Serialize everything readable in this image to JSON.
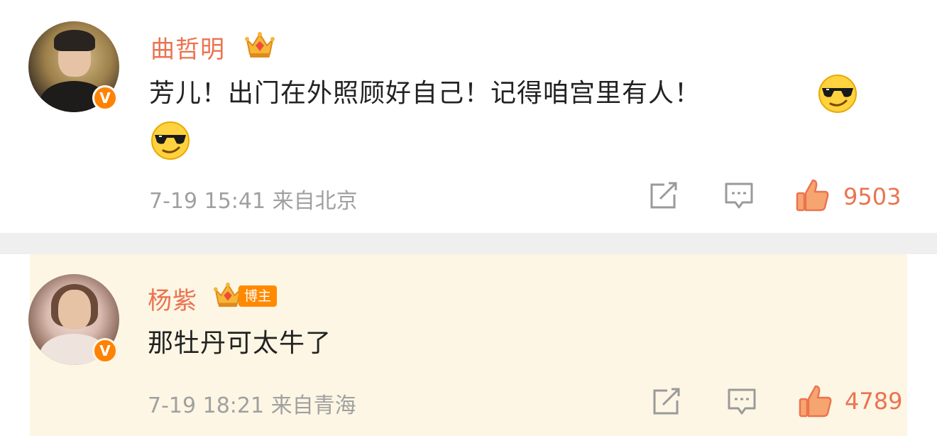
{
  "comments": [
    {
      "author": "曲哲明",
      "text": "芳儿！出门在外照顾好自己！记得咱宫里有人！",
      "emojis": [
        "cool-sunglasses-emoji",
        "cool-sunglasses-emoji"
      ],
      "time": "7-19 15:41",
      "location": "来自北京",
      "likes": "9503"
    },
    {
      "author": "杨紫",
      "badge": "博主",
      "text": "那牡丹可太牛了",
      "time": "7-19 18:21",
      "location": "来自青海",
      "likes": "4789"
    }
  ],
  "colors": {
    "name": "#eb7350",
    "verified": "#ff8200",
    "meta": "#a0a0a0",
    "highlight_bg": "#fdf6e4",
    "separator": "#efefef"
  },
  "icons": [
    "verified-v-icon",
    "crown-icon",
    "share-icon",
    "comment-icon",
    "like-thumb-icon"
  ]
}
